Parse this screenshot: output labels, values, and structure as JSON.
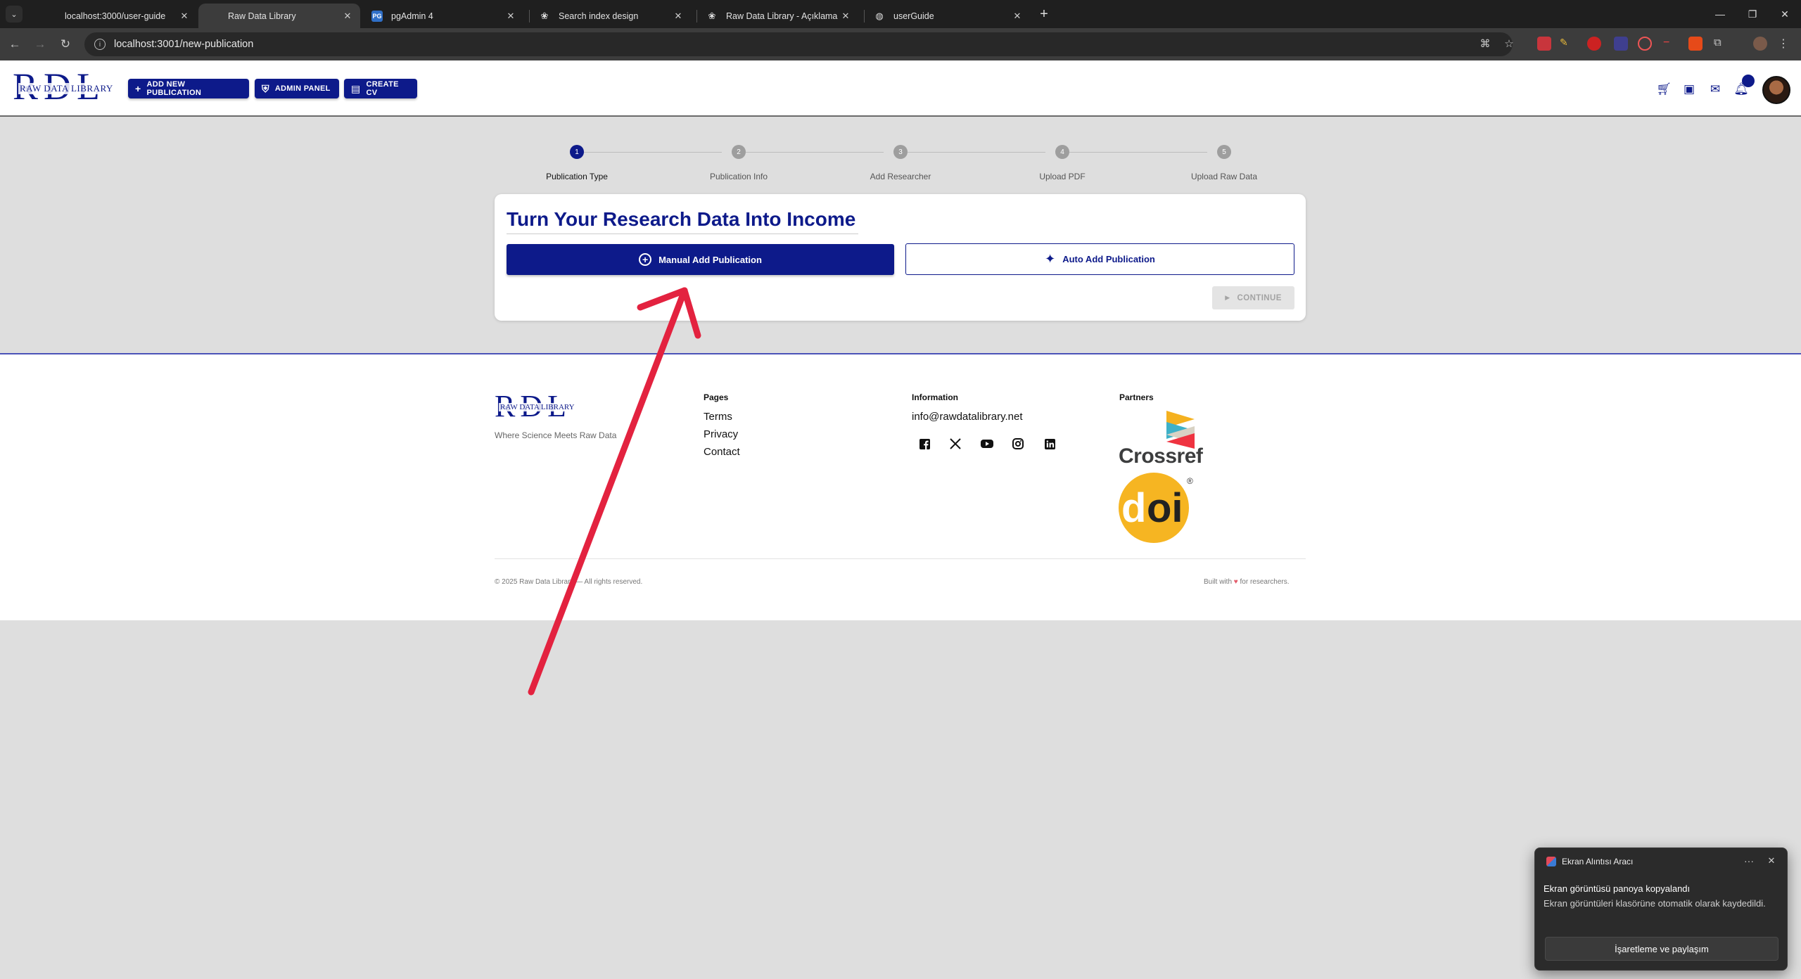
{
  "browser": {
    "tabs": [
      {
        "title": "localhost:3000/user-guide"
      },
      {
        "title": "Raw Data Library"
      },
      {
        "title": "pgAdmin 4"
      },
      {
        "title": "Search index design"
      },
      {
        "title": "Raw Data Library - Açıklama ve"
      },
      {
        "title": "userGuide"
      }
    ],
    "active_tab_index": 1,
    "url": "localhost:3001/new-publication"
  },
  "header": {
    "logo_big": "RDL",
    "logo_small": "RAW DATA LIBRARY",
    "buttons": {
      "add_publication": "ADD NEW PUBLICATION",
      "admin_panel": "ADMIN PANEL",
      "create_cv": "CREATE CV"
    }
  },
  "stepper": {
    "steps": [
      {
        "number": "1",
        "label": "Publication Type"
      },
      {
        "number": "2",
        "label": "Publication Info"
      },
      {
        "number": "3",
        "label": "Add Researcher"
      },
      {
        "number": "4",
        "label": "Upload PDF"
      },
      {
        "number": "5",
        "label": "Upload Raw Data"
      }
    ],
    "active_step": 1
  },
  "card": {
    "title": "Turn Your Research Data Into Income",
    "manual_button": "Manual Add Publication",
    "auto_button": "Auto Add Publication",
    "continue_button": "CONTINUE"
  },
  "footer": {
    "logo_big": "RDL",
    "logo_small": "RAW DATA LIBRARY",
    "tagline": "Where Science Meets Raw Data",
    "pages_heading": "Pages",
    "pages": [
      "Terms",
      "Privacy",
      "Contact"
    ],
    "information_heading": "Information",
    "email": "info@rawdatalibrary.net",
    "partners_heading": "Partners",
    "crossref_label": "Crossref",
    "doi_label": "doi",
    "copyright": "© 2025 Raw Data Library — All rights reserved.",
    "built_with_prefix": "Built with",
    "built_with_suffix": "for researchers."
  },
  "toast": {
    "app_name": "Ekran Alıntısı Aracı",
    "title": "Ekran görüntüsü panoya kopyalandı",
    "body": "Ekran görüntüleri klasörüne otomatik olarak kaydedildi.",
    "action": "İşaretleme ve paylaşım"
  },
  "colors": {
    "brand": "#0d1a8a",
    "annotation_arrow": "#e3223f",
    "doi_yellow": "#f6b522"
  }
}
